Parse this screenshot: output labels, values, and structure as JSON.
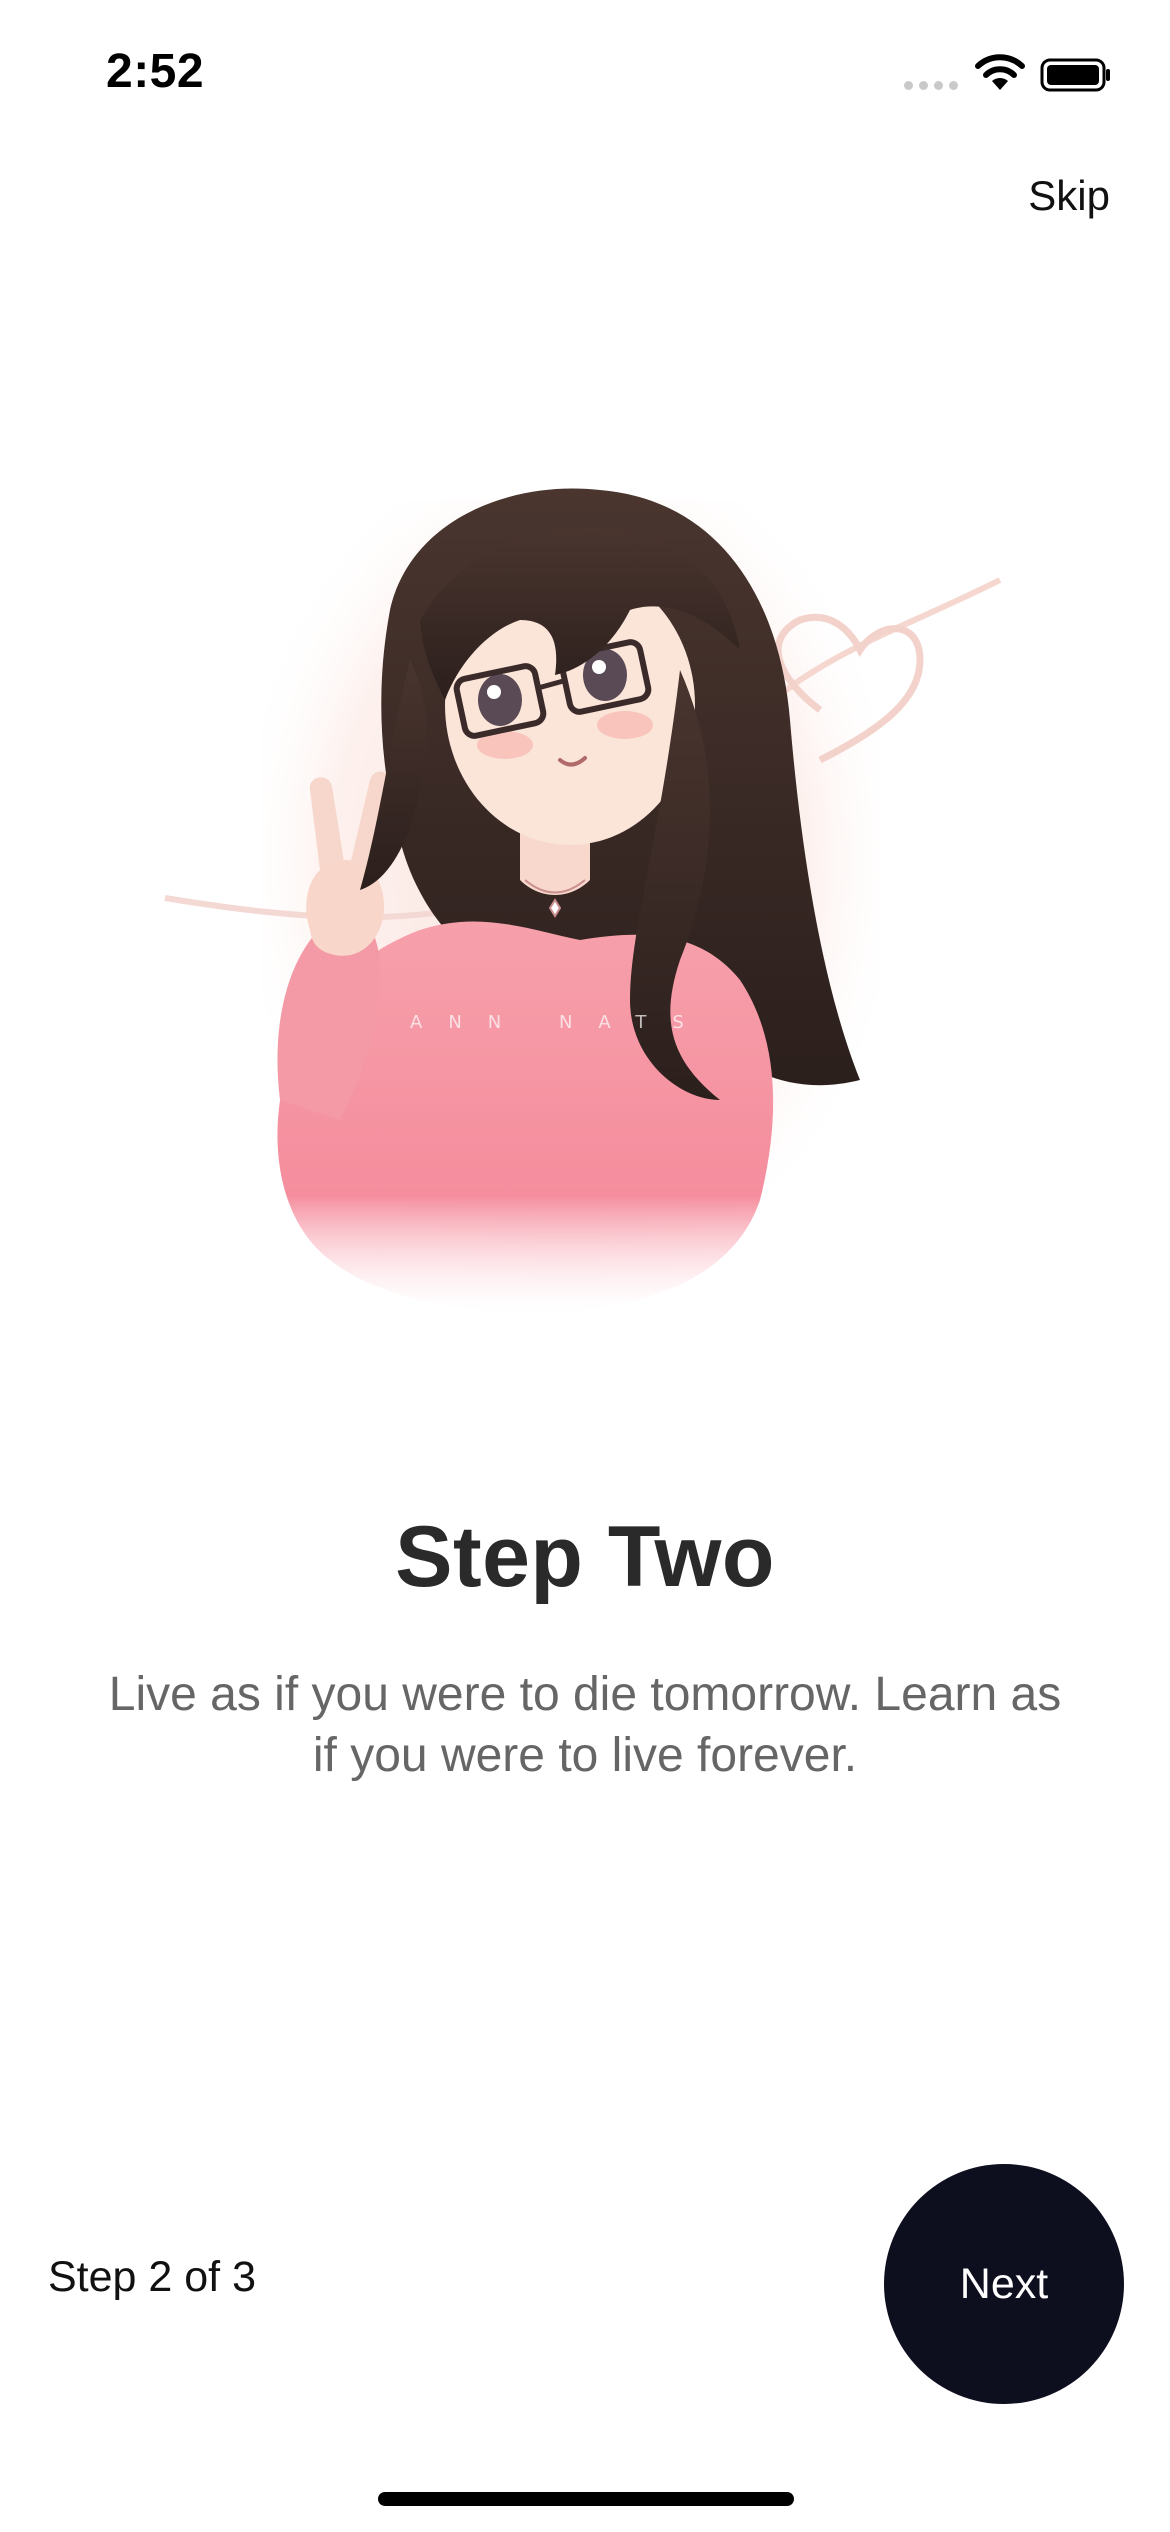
{
  "status_bar": {
    "time": "2:52",
    "icons": [
      "signal-icon",
      "wifi-icon",
      "battery-icon"
    ]
  },
  "header": {
    "skip_label": "Skip"
  },
  "illustration": {
    "icon": "anime-girl-illustration",
    "watermark": "ANN NATS"
  },
  "content": {
    "title": "Step Two",
    "subtitle": "Live as if you were to die tomorrow. Learn as if you were to live forever."
  },
  "footer": {
    "step_text": "Step 2 of 3",
    "next_label": "Next"
  },
  "colors": {
    "primary_button": "#0d0e1e",
    "title_text": "#2a2a2a",
    "subtitle_text": "#666666",
    "sweater_pink": "#f48fa0",
    "hair_brown": "#3b2a26"
  }
}
